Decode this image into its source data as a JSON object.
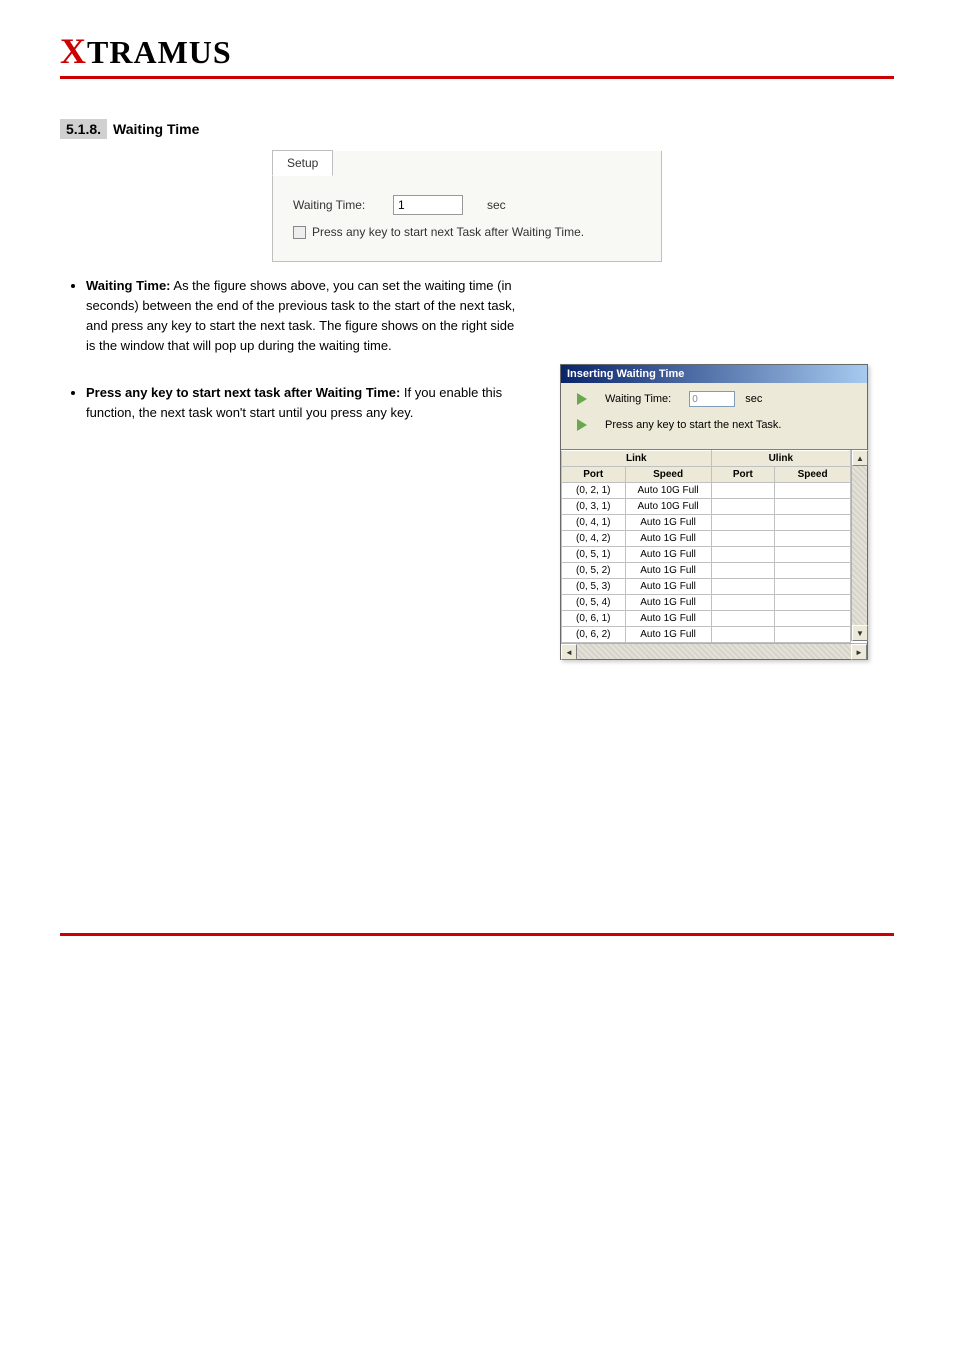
{
  "logo": {
    "x": "X",
    "rest": "TRAMUS"
  },
  "section": {
    "number": "5.1.8.",
    "title": "Waiting Time"
  },
  "setup_panel": {
    "tab": "Setup",
    "waiting_label": "Waiting Time:",
    "waiting_value": "1",
    "sec": "sec",
    "checkbox_label": "Press any key to start next Task after Waiting Time."
  },
  "bullets": [
    {
      "bold": "Waiting Time:",
      "text": " As the figure shows above, you can set the waiting time (in seconds) between the end of the previous task to the start of the next task, and press any key to start the next task. The figure shows on the right side is the window that will pop up during the waiting time."
    },
    {
      "bold": "Press any key to start next task after Waiting Time:",
      "text": " If you enable this function, the next task won't start until you press any key."
    }
  ],
  "popup": {
    "title": "Inserting Waiting Time",
    "waiting_label": "Waiting Time:",
    "waiting_value": "0",
    "sec": "sec",
    "line2": "Press any key to start the next Task.",
    "headers": {
      "link": "Link",
      "ulink": "Ulink",
      "port": "Port",
      "speed": "Speed"
    },
    "rows": [
      {
        "port": "(0, 2, 1)",
        "speed": "Auto 10G Full"
      },
      {
        "port": "(0, 3, 1)",
        "speed": "Auto 10G Full"
      },
      {
        "port": "(0, 4, 1)",
        "speed": "Auto 1G Full"
      },
      {
        "port": "(0, 4, 2)",
        "speed": "Auto 1G Full"
      },
      {
        "port": "(0, 5, 1)",
        "speed": "Auto 1G Full"
      },
      {
        "port": "(0, 5, 2)",
        "speed": "Auto 1G Full"
      },
      {
        "port": "(0, 5, 3)",
        "speed": "Auto 1G Full"
      },
      {
        "port": "(0, 5, 4)",
        "speed": "Auto 1G Full"
      },
      {
        "port": "(0, 6, 1)",
        "speed": "Auto 1G Full"
      },
      {
        "port": "(0, 6, 2)",
        "speed": "Auto 1G Full"
      }
    ]
  }
}
